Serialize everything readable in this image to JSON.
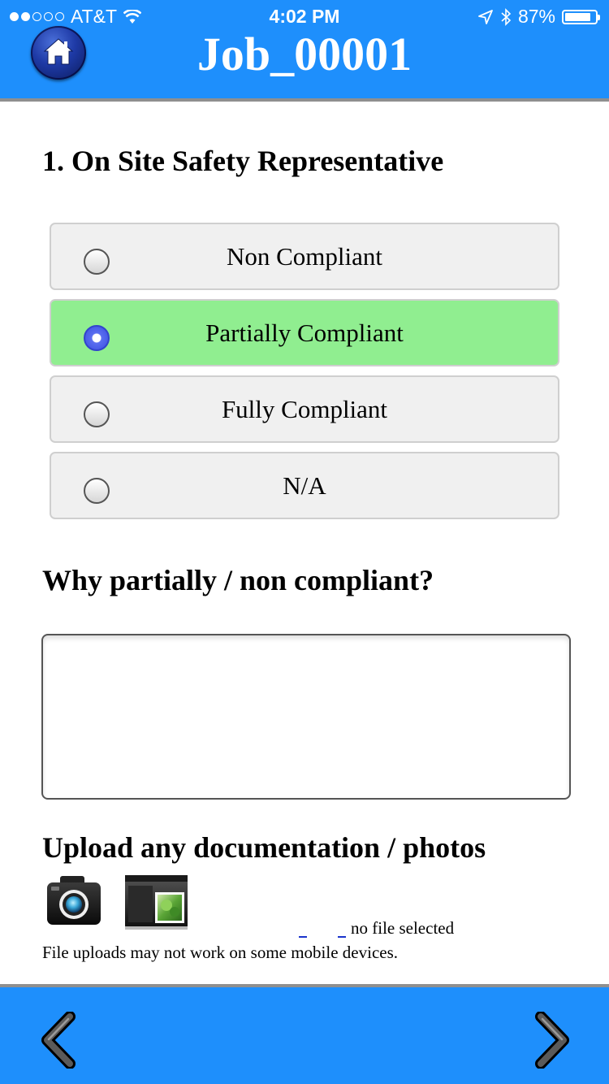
{
  "status_bar": {
    "carrier": "AT&T",
    "time": "4:02 PM",
    "battery": "87%",
    "battery_level": 0.87,
    "signal_bars_filled": 2,
    "signal_bars_total": 5
  },
  "header": {
    "title": "Job_00001",
    "home_icon": "home-icon",
    "background_color": "#1e8ffc"
  },
  "question": {
    "title": "1. On Site Safety Representative",
    "options": [
      {
        "label": "Non Compliant",
        "selected": false
      },
      {
        "label": "Partially Compliant",
        "selected": true
      },
      {
        "label": "Fully Compliant",
        "selected": false
      },
      {
        "label": "N/A",
        "selected": false
      }
    ],
    "selected_color": "#90ee90"
  },
  "reason": {
    "heading": "Why partially / non compliant?",
    "value": ""
  },
  "upload": {
    "heading": "Upload any documentation / photos",
    "camera_icon": "camera-icon",
    "gallery_icon": "photo-gallery-icon",
    "file_status": "no file selected",
    "note": "File uploads may not work on some mobile devices."
  },
  "footer": {
    "prev_icon": "chevron-left-icon",
    "next_icon": "chevron-right-icon"
  }
}
